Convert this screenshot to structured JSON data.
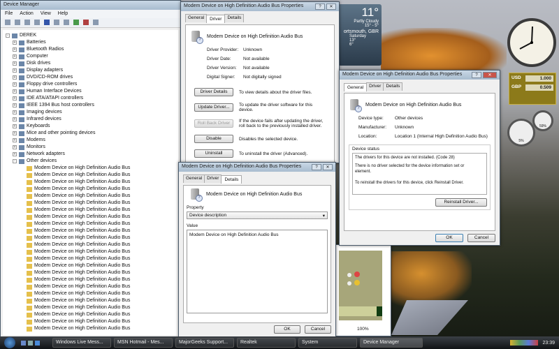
{
  "device_manager": {
    "title": "Device Manager",
    "menu": [
      "File",
      "Action",
      "View",
      "Help"
    ],
    "root": "DEREK",
    "categories": [
      "Batteries",
      "Bluetooth Radios",
      "Computer",
      "Disk drives",
      "Display adapters",
      "DVD/CD-ROM drives",
      "Floppy drive controllers",
      "Human Interface Devices",
      "IDE ATA/ATAPI controllers",
      "IEEE 1394 Bus host controllers",
      "Imaging devices",
      "Infrared devices",
      "Keyboards",
      "Mice and other pointing devices",
      "Modems",
      "Monitors",
      "Network adapters",
      "Other devices"
    ],
    "other_device_item": "Modem Device on High Definition Audio Bus",
    "other_device_count": 24
  },
  "driver_dialog": {
    "title": "Modem Device on High Definition Audio Bus Properties",
    "tabs": [
      "General",
      "Driver",
      "Details"
    ],
    "device": "Modem Device on High Definition Audio Bus",
    "fields": [
      {
        "k": "Driver Provider:",
        "v": "Unknown"
      },
      {
        "k": "Driver Date:",
        "v": "Not available"
      },
      {
        "k": "Driver Version:",
        "v": "Not available"
      },
      {
        "k": "Digital Signer:",
        "v": "Not digitally signed"
      }
    ],
    "buttons": [
      {
        "label": "Driver Details",
        "desc": "To view details about the driver files.",
        "disabled": false
      },
      {
        "label": "Update Driver...",
        "desc": "To update the driver software for this device.",
        "disabled": false
      },
      {
        "label": "Roll Back Driver",
        "desc": "If the device fails after updating the driver, roll back to the previously installed driver.",
        "disabled": true
      },
      {
        "label": "Disable",
        "desc": "Disables the selected device.",
        "disabled": false
      },
      {
        "label": "Uninstall",
        "desc": "To uninstall the driver (Advanced).",
        "disabled": false
      }
    ]
  },
  "details_dialog": {
    "title": "Modem Device on High Definition Audio Bus Properties",
    "tabs": [
      "General",
      "Driver",
      "Details"
    ],
    "device": "Modem Device on High Definition Audio Bus",
    "property_label": "Property",
    "property_value": "Device description",
    "value_label": "Value",
    "value": "Modem Device on High Definition Audio Bus",
    "ok": "OK",
    "cancel": "Cancel"
  },
  "general_dialog": {
    "title": "Modem Device on High Definition Audio Bus Properties",
    "tabs": [
      "General",
      "Driver",
      "Details"
    ],
    "device": "Modem Device on High Definition Audio Bus",
    "fields": [
      {
        "k": "Device type:",
        "v": "Other devices"
      },
      {
        "k": "Manufacturer:",
        "v": "Unknown"
      },
      {
        "k": "Location:",
        "v": "Location 1 (Internal High Definition Audio Bus)"
      }
    ],
    "status_label": "Device status",
    "status_lines": [
      "The drivers for this device are not installed. (Code 28)",
      "There is no driver selected for the device information set or element.",
      "To reinstall the drivers for this device, click Reinstall Driver."
    ],
    "reinstall": "Reinstall Driver...",
    "ok": "OK",
    "cancel": "Cancel"
  },
  "weather": {
    "temp": "11°",
    "cond": "Partly Cloudy",
    "range": "15° - 5°",
    "city": "ortsmouth, GBR",
    "day": "Saturday",
    "hi": "13°",
    "lo": "6°"
  },
  "currency": {
    "from": "USD",
    "from_val": "1.000",
    "to": "GBP",
    "to_val": "0.509"
  },
  "cpu": {
    "cpu": "5%",
    "mem": "59%"
  },
  "zoom_level": "100%",
  "taskbar": {
    "items": [
      "Windows Live Mess...",
      "MSN Hotmail - Mes...",
      "MajorGeeks Support...",
      "Realtek",
      "System",
      "Device Manager"
    ],
    "clock": "23:39"
  }
}
